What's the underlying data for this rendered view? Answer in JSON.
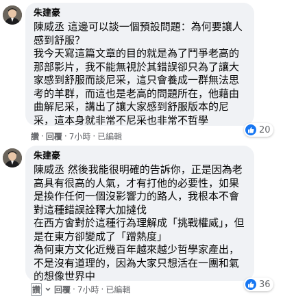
{
  "comments": [
    {
      "author": "朱建豪",
      "text": "陳威丞 這邊可以談一個預設問題：為何要讓人感到舒服？\n我今天寫這篇文章的目的就是為了鬥爭老高的那部影片，我不能無視於其錯誤卻只為了讓大家感到舒服而談尼采，這只會養成一群無法思考的羊群，而這也是老高的問題所在，他藉由曲解尼采，講出了讓大家感到舒服版本的尼采，這本身就非常不尼采也非常不哲學",
      "actions": {
        "like": "讚",
        "reply": "回覆",
        "time": "7小時",
        "edited": "已編輯"
      },
      "reaction_count": "20",
      "reaction_icon": "thumbs-up-icon"
    },
    {
      "author": "朱建豪",
      "text": "陳威丞 然後我能很明確的告訴你，正是因為老高具有很高的人氣，才有打他的必要性，如果是換作任何一個沒影響力的路人，我根本不會對這種錯誤詮釋大加撻伐\n在西方會對於這種行為理解成「挑戰權威」，但是在東方卻變成了「蹭熱度」\n為何東方文化近幾百年越來越少哲學家產出，不是沒有道理的，因為大家只想活在一團和氣的想像世界中",
      "actions": {
        "like": "讚",
        "reply": "回覆",
        "time": "7小時",
        "edited": "已編輯"
      },
      "reaction_count": "36",
      "reaction_icon": "thumbs-up-icon"
    }
  ],
  "colors": {
    "bubble": "#f0f2f5",
    "like_blue": "#1877f2",
    "meta": "#65676b"
  }
}
